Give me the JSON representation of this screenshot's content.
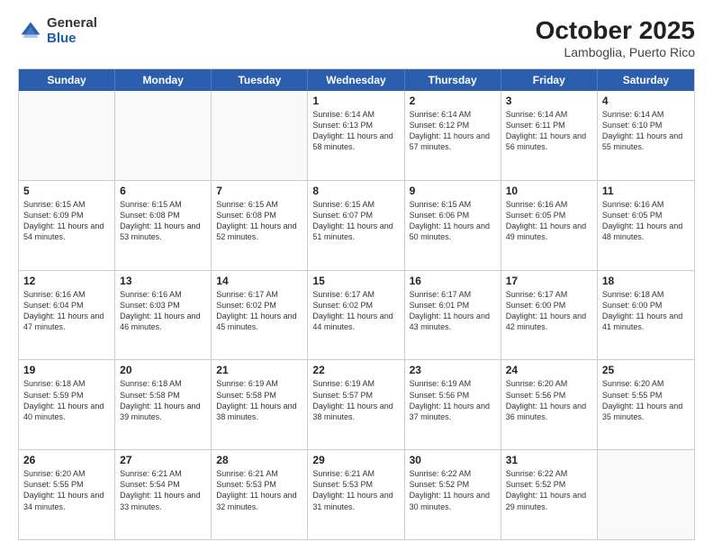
{
  "header": {
    "logo_general": "General",
    "logo_blue": "Blue",
    "month_year": "October 2025",
    "location": "Lamboglia, Puerto Rico"
  },
  "weekdays": [
    "Sunday",
    "Monday",
    "Tuesday",
    "Wednesday",
    "Thursday",
    "Friday",
    "Saturday"
  ],
  "weeks": [
    [
      {
        "day": "",
        "empty": true
      },
      {
        "day": "",
        "empty": true
      },
      {
        "day": "",
        "empty": true
      },
      {
        "day": "1",
        "sunrise": "6:14 AM",
        "sunset": "6:13 PM",
        "daylight": "11 hours and 58 minutes."
      },
      {
        "day": "2",
        "sunrise": "6:14 AM",
        "sunset": "6:12 PM",
        "daylight": "11 hours and 57 minutes."
      },
      {
        "day": "3",
        "sunrise": "6:14 AM",
        "sunset": "6:11 PM",
        "daylight": "11 hours and 56 minutes."
      },
      {
        "day": "4",
        "sunrise": "6:14 AM",
        "sunset": "6:10 PM",
        "daylight": "11 hours and 55 minutes."
      }
    ],
    [
      {
        "day": "5",
        "sunrise": "6:15 AM",
        "sunset": "6:09 PM",
        "daylight": "11 hours and 54 minutes."
      },
      {
        "day": "6",
        "sunrise": "6:15 AM",
        "sunset": "6:08 PM",
        "daylight": "11 hours and 53 minutes."
      },
      {
        "day": "7",
        "sunrise": "6:15 AM",
        "sunset": "6:08 PM",
        "daylight": "11 hours and 52 minutes."
      },
      {
        "day": "8",
        "sunrise": "6:15 AM",
        "sunset": "6:07 PM",
        "daylight": "11 hours and 51 minutes."
      },
      {
        "day": "9",
        "sunrise": "6:15 AM",
        "sunset": "6:06 PM",
        "daylight": "11 hours and 50 minutes."
      },
      {
        "day": "10",
        "sunrise": "6:16 AM",
        "sunset": "6:05 PM",
        "daylight": "11 hours and 49 minutes."
      },
      {
        "day": "11",
        "sunrise": "6:16 AM",
        "sunset": "6:05 PM",
        "daylight": "11 hours and 48 minutes."
      }
    ],
    [
      {
        "day": "12",
        "sunrise": "6:16 AM",
        "sunset": "6:04 PM",
        "daylight": "11 hours and 47 minutes."
      },
      {
        "day": "13",
        "sunrise": "6:16 AM",
        "sunset": "6:03 PM",
        "daylight": "11 hours and 46 minutes."
      },
      {
        "day": "14",
        "sunrise": "6:17 AM",
        "sunset": "6:02 PM",
        "daylight": "11 hours and 45 minutes."
      },
      {
        "day": "15",
        "sunrise": "6:17 AM",
        "sunset": "6:02 PM",
        "daylight": "11 hours and 44 minutes."
      },
      {
        "day": "16",
        "sunrise": "6:17 AM",
        "sunset": "6:01 PM",
        "daylight": "11 hours and 43 minutes."
      },
      {
        "day": "17",
        "sunrise": "6:17 AM",
        "sunset": "6:00 PM",
        "daylight": "11 hours and 42 minutes."
      },
      {
        "day": "18",
        "sunrise": "6:18 AM",
        "sunset": "6:00 PM",
        "daylight": "11 hours and 41 minutes."
      }
    ],
    [
      {
        "day": "19",
        "sunrise": "6:18 AM",
        "sunset": "5:59 PM",
        "daylight": "11 hours and 40 minutes."
      },
      {
        "day": "20",
        "sunrise": "6:18 AM",
        "sunset": "5:58 PM",
        "daylight": "11 hours and 39 minutes."
      },
      {
        "day": "21",
        "sunrise": "6:19 AM",
        "sunset": "5:58 PM",
        "daylight": "11 hours and 38 minutes."
      },
      {
        "day": "22",
        "sunrise": "6:19 AM",
        "sunset": "5:57 PM",
        "daylight": "11 hours and 38 minutes."
      },
      {
        "day": "23",
        "sunrise": "6:19 AM",
        "sunset": "5:56 PM",
        "daylight": "11 hours and 37 minutes."
      },
      {
        "day": "24",
        "sunrise": "6:20 AM",
        "sunset": "5:56 PM",
        "daylight": "11 hours and 36 minutes."
      },
      {
        "day": "25",
        "sunrise": "6:20 AM",
        "sunset": "5:55 PM",
        "daylight": "11 hours and 35 minutes."
      }
    ],
    [
      {
        "day": "26",
        "sunrise": "6:20 AM",
        "sunset": "5:55 PM",
        "daylight": "11 hours and 34 minutes."
      },
      {
        "day": "27",
        "sunrise": "6:21 AM",
        "sunset": "5:54 PM",
        "daylight": "11 hours and 33 minutes."
      },
      {
        "day": "28",
        "sunrise": "6:21 AM",
        "sunset": "5:53 PM",
        "daylight": "11 hours and 32 minutes."
      },
      {
        "day": "29",
        "sunrise": "6:21 AM",
        "sunset": "5:53 PM",
        "daylight": "11 hours and 31 minutes."
      },
      {
        "day": "30",
        "sunrise": "6:22 AM",
        "sunset": "5:52 PM",
        "daylight": "11 hours and 30 minutes."
      },
      {
        "day": "31",
        "sunrise": "6:22 AM",
        "sunset": "5:52 PM",
        "daylight": "11 hours and 29 minutes."
      },
      {
        "day": "",
        "empty": true
      }
    ]
  ]
}
